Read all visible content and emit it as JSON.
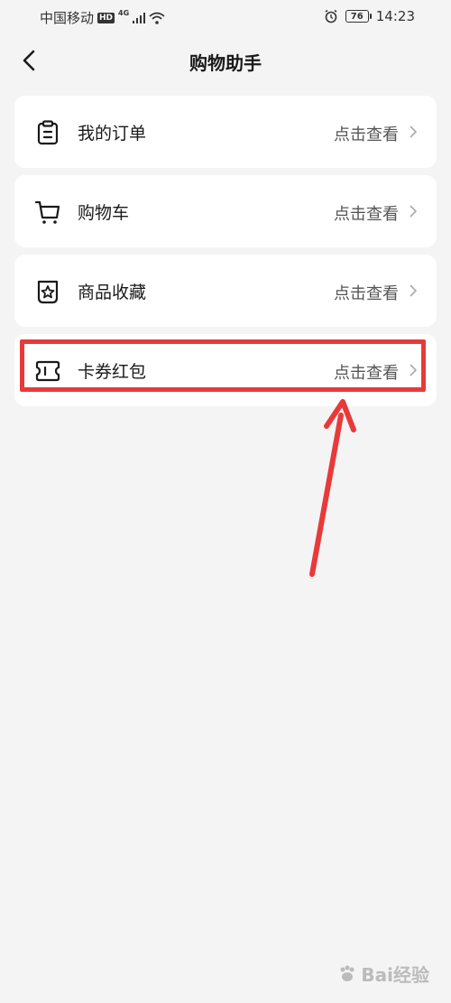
{
  "status_bar": {
    "carrier": "中国移动",
    "hd": "HD",
    "network": "4G",
    "battery": "76",
    "time": "14:23"
  },
  "header": {
    "title": "购物助手"
  },
  "menu": {
    "items": [
      {
        "label": "我的订单",
        "action": "点击查看",
        "icon": "clipboard-icon"
      },
      {
        "label": "购物车",
        "action": "点击查看",
        "icon": "cart-icon"
      },
      {
        "label": "商品收藏",
        "action": "点击查看",
        "icon": "favorite-star-icon"
      },
      {
        "label": "卡券红包",
        "action": "点击查看",
        "icon": "coupon-ticket-icon"
      }
    ]
  },
  "annotation": {
    "highlight_color": "#e83a3a"
  },
  "watermark": {
    "text": "Bai经验"
  }
}
